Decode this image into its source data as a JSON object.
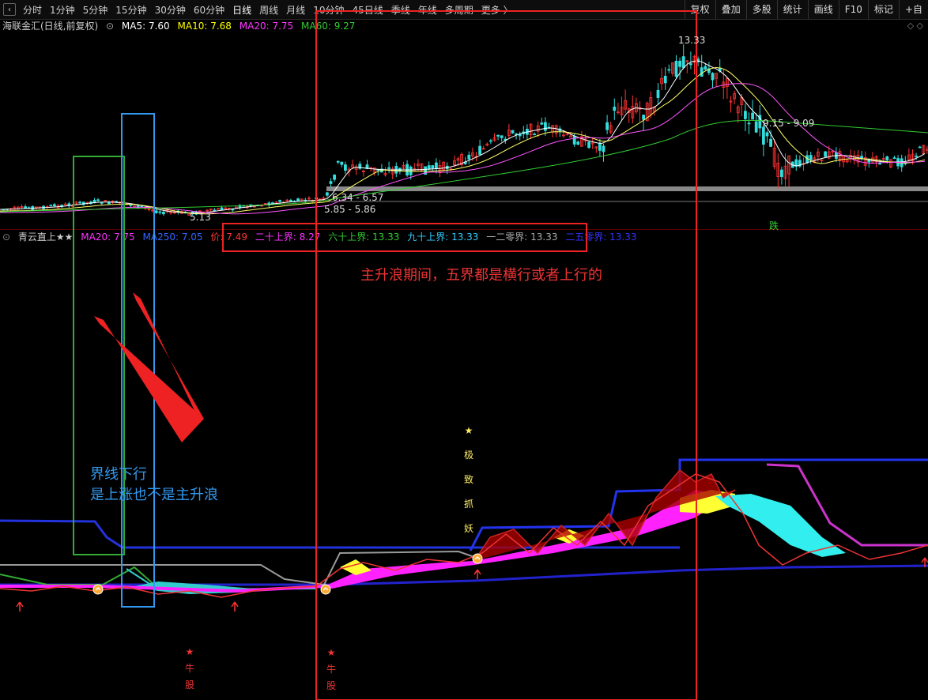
{
  "toolbar": {
    "back_icon": "‹",
    "periods": [
      "分时",
      "1分钟",
      "5分钟",
      "15分钟",
      "30分钟",
      "60分钟",
      "日线",
      "周线",
      "月线",
      "10分钟",
      "45日线",
      "季线",
      "年线",
      "多周期",
      "更多 〉"
    ],
    "active_period": "日线",
    "right_buttons": [
      "复权",
      "叠加",
      "多股",
      "统计",
      "画线",
      "F10",
      "标记",
      "+自"
    ]
  },
  "price_header": {
    "title": "海联金汇(日线,前复权)",
    "ma5": "MA5: 7.60",
    "ma10": "MA10: 7.68",
    "ma20": "MA20: 7.75",
    "ma60": "MA60: 9.27",
    "colors": {
      "title": "#d0d0d0",
      "ma5": "#ffffff",
      "ma10": "#ffff00",
      "ma20": "#ff33ff",
      "ma60": "#33cc33"
    }
  },
  "price_labels": {
    "high": "13.33",
    "mid": "9.15 - 9.09",
    "low_left": "5.13",
    "range1": "6.34 - 6.57",
    "range2": "5.85 - 5.86",
    "fall_marker": "跌"
  },
  "window_controls": "◇ ◇",
  "indicator_header": {
    "title": "青云直上★★",
    "ma20": "MA20: 7.75",
    "ma250": "MA250: 7.05",
    "price": "价: 7.49",
    "b20": "二十上界: 8.27",
    "b60": "六十上界: 13.33",
    "b90": "九十上界: 13.33",
    "b120": "一二零界: 13.33",
    "b250": "二五零界: 13.33",
    "colors": {
      "title": "#d0d0d0",
      "ma20": "#ff33ff",
      "ma250": "#3366ff",
      "price": "#ff3333",
      "b20": "#ff33ff",
      "b60": "#33cc33",
      "b90": "#33ccff",
      "b120": "#aaaaaa",
      "b250": "#3333ff"
    }
  },
  "annotations": {
    "red_note": "主升浪期间，五界都是横行或者上行的",
    "blue_note_line1": "界线下行",
    "blue_note_line2": "是上涨也不是主升浪",
    "signal_vertical": [
      "★",
      "极",
      "致",
      "抓",
      "妖"
    ],
    "niu_gu_1": [
      "★",
      "牛",
      "股"
    ],
    "niu_gu_2": [
      "★",
      "牛",
      "股"
    ]
  },
  "chart_data": {
    "type": "candlestick",
    "title": "海联金汇(日线,前复权)",
    "price_markers": {
      "high": 13.33,
      "mid_range": [
        9.15,
        9.09
      ],
      "low": 5.13,
      "range1": [
        6.34,
        6.57
      ],
      "range2": [
        5.85,
        5.86
      ]
    },
    "ma_latest": {
      "MA5": 7.6,
      "MA10": 7.68,
      "MA20": 7.75,
      "MA60": 9.27
    },
    "indicator_latest": {
      "MA20": 7.75,
      "MA250": 7.05,
      "price": 7.49,
      "二十上界": 8.27,
      "六十上界": 13.33,
      "九十上界": 13.33,
      "一二零界": 13.33,
      "二五零界": 13.33
    }
  }
}
